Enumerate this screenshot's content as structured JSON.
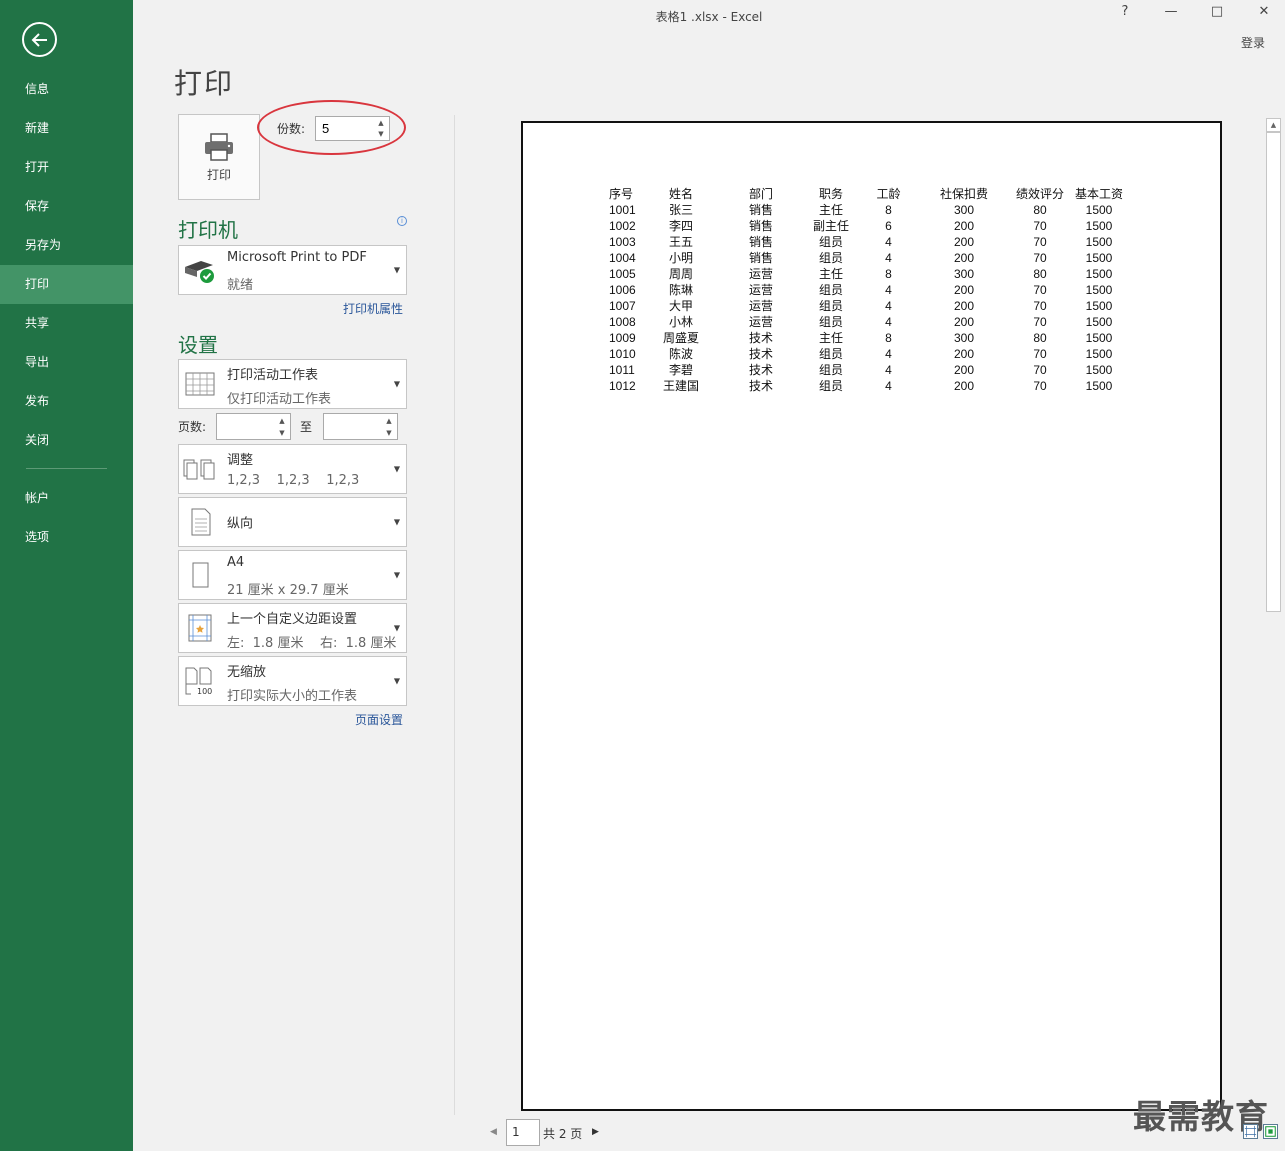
{
  "window": {
    "title": "表格1 .xlsx - Excel",
    "help": "?",
    "minimize": "—",
    "restore": "□",
    "close": "✕",
    "login": "登录"
  },
  "sidebar": {
    "items": [
      {
        "label": "信息"
      },
      {
        "label": "新建"
      },
      {
        "label": "打开"
      },
      {
        "label": "保存"
      },
      {
        "label": "另存为"
      },
      {
        "label": "打印"
      },
      {
        "label": "共享"
      },
      {
        "label": "导出"
      },
      {
        "label": "发布"
      },
      {
        "label": "关闭"
      }
    ],
    "bottom_items": [
      {
        "label": "帐户"
      },
      {
        "label": "选项"
      }
    ]
  },
  "print": {
    "title": "打印",
    "print_button": "打印",
    "copies_label": "份数:",
    "copies_value": "5"
  },
  "printer": {
    "section_title": "打印机",
    "name": "Microsoft Print to PDF",
    "status": "就绪",
    "properties_link": "打印机属性"
  },
  "settings": {
    "section_title": "设置",
    "scope": {
      "line1": "打印活动工作表",
      "line2": "仅打印活动工作表"
    },
    "pages_label": "页数:",
    "to_label": "至",
    "collate": {
      "line1": "调整",
      "line2": "1,2,3    1,2,3    1,2,3"
    },
    "orientation": {
      "label": "纵向"
    },
    "paper": {
      "line1": "A4",
      "line2": "21 厘米 x 29.7 厘米"
    },
    "margins": {
      "line1": "上一个自定义边距设置",
      "line2": "左:  1.8 厘米    右:  1.8 厘米"
    },
    "scaling": {
      "line1": "无缩放",
      "line2": "打印实际大小的工作表",
      "icon_text": "100"
    },
    "page_setup_link": "页面设置"
  },
  "preview": {
    "headers": [
      "序号",
      "姓名",
      "部门",
      "职务",
      "工龄",
      "社保扣费",
      "绩效评分",
      "基本工资"
    ],
    "rows": [
      [
        "1001",
        "张三",
        "销售",
        "主任",
        "8",
        "300",
        "80",
        "1500"
      ],
      [
        "1002",
        "李四",
        "销售",
        "副主任",
        "6",
        "200",
        "70",
        "1500"
      ],
      [
        "1003",
        "王五",
        "销售",
        "组员",
        "4",
        "200",
        "70",
        "1500"
      ],
      [
        "1004",
        "小明",
        "销售",
        "组员",
        "4",
        "200",
        "70",
        "1500"
      ],
      [
        "1005",
        "周周",
        "运营",
        "主任",
        "8",
        "300",
        "80",
        "1500"
      ],
      [
        "1006",
        "陈琳",
        "运营",
        "组员",
        "4",
        "200",
        "70",
        "1500"
      ],
      [
        "1007",
        "大甲",
        "运营",
        "组员",
        "4",
        "200",
        "70",
        "1500"
      ],
      [
        "1008",
        "小林",
        "运营",
        "组员",
        "4",
        "200",
        "70",
        "1500"
      ],
      [
        "1009",
        "周盛夏",
        "技术",
        "主任",
        "8",
        "300",
        "80",
        "1500"
      ],
      [
        "1010",
        "陈波",
        "技术",
        "组员",
        "4",
        "200",
        "70",
        "1500"
      ],
      [
        "1011",
        "李碧",
        "技术",
        "组员",
        "4",
        "200",
        "70",
        "1500"
      ],
      [
        "1012",
        "王建国",
        "技术",
        "组员",
        "4",
        "200",
        "70",
        "1500"
      ]
    ]
  },
  "page_nav": {
    "current": "1",
    "total": "共 2 页"
  },
  "watermark": "最需教育",
  "colors": {
    "accent": "#217346",
    "active": "#439467",
    "highlight": "#d9363e",
    "link": "#2b579a"
  }
}
